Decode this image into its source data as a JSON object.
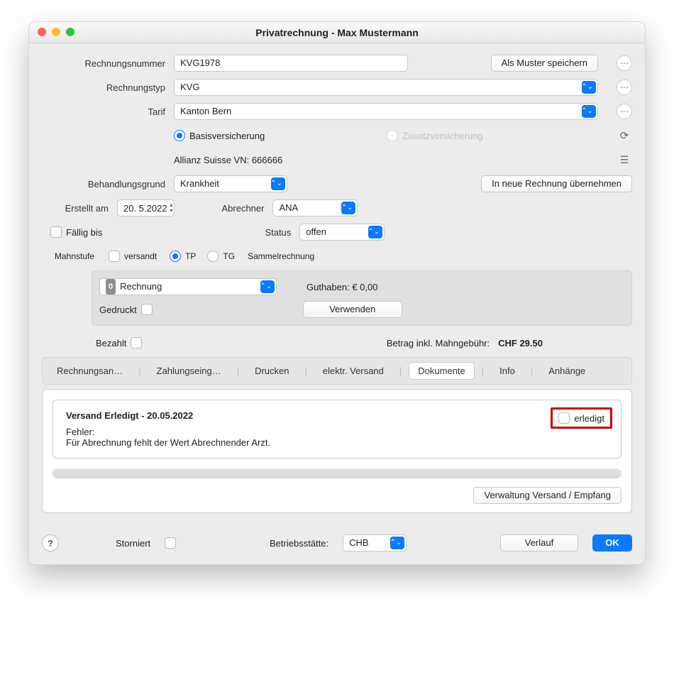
{
  "window": {
    "title": "Privatrechnung - Max Mustermann"
  },
  "fields": {
    "rechnungsnummer_label": "Rechnungsnummer",
    "rechnungsnummer": "KVG1978",
    "als_muster_speichern": "Als Muster speichern",
    "rechnungstyp_label": "Rechnungstyp",
    "rechnungstyp": "KVG",
    "tarif_label": "Tarif",
    "tarif": "Kanton Bern",
    "basisversicherung": "Basisversicherung",
    "zusatzversicherung": "Zusatzversicherung",
    "versicherung_info": "Allianz Suisse   VN: 666666",
    "behandlungsgrund_label": "Behandlungsgrund",
    "behandlungsgrund": "Krankheit",
    "in_neue_rechnung": "In neue Rechnung übernehmen",
    "erstellt_am_label": "Erstellt am",
    "erstellt_am": "20.  5.2022",
    "abrechner_label": "Abrechner",
    "abrechner": "ANA",
    "faellig_bis_label": "Fällig bis",
    "status_label": "Status",
    "status": "offen",
    "mahnstufe_label": "Mahnstufe",
    "versandt_label": "versandt",
    "tp_label": "TP",
    "tg_label": "TG",
    "sammelrechnung": "Sammelrechnung",
    "rechnung_counter": "0",
    "rechnung_select": "Rechnung",
    "guthaben_label": "Guthaben: € 0,00",
    "gedruckt_label": "Gedruckt",
    "verwenden": "Verwenden",
    "bezahlt_label": "Bezahlt",
    "betrag_label": "Betrag inkl. Mahngebühr:",
    "betrag_value": "CHF 29.50"
  },
  "tabs": [
    "Rechnungsan…",
    "Zahlungseing…",
    "Drucken",
    "elektr. Versand",
    "Dokumente",
    "Info",
    "Anhänge"
  ],
  "active_tab": "Dokumente",
  "doc": {
    "title": "Versand Erledigt - 20.05.2022",
    "err_label": "Fehler:",
    "err_text": "Für Abrechnung fehlt der Wert Abrechnender Arzt.",
    "erledigt_label": "erledigt"
  },
  "panel_footer_btn": "Verwaltung Versand / Empfang",
  "footer": {
    "storniert_label": "Storniert",
    "betriebsstaette_label": "Betriebsstätte:",
    "betriebsstaette": "CHB",
    "verlauf": "Verlauf",
    "ok": "OK"
  }
}
